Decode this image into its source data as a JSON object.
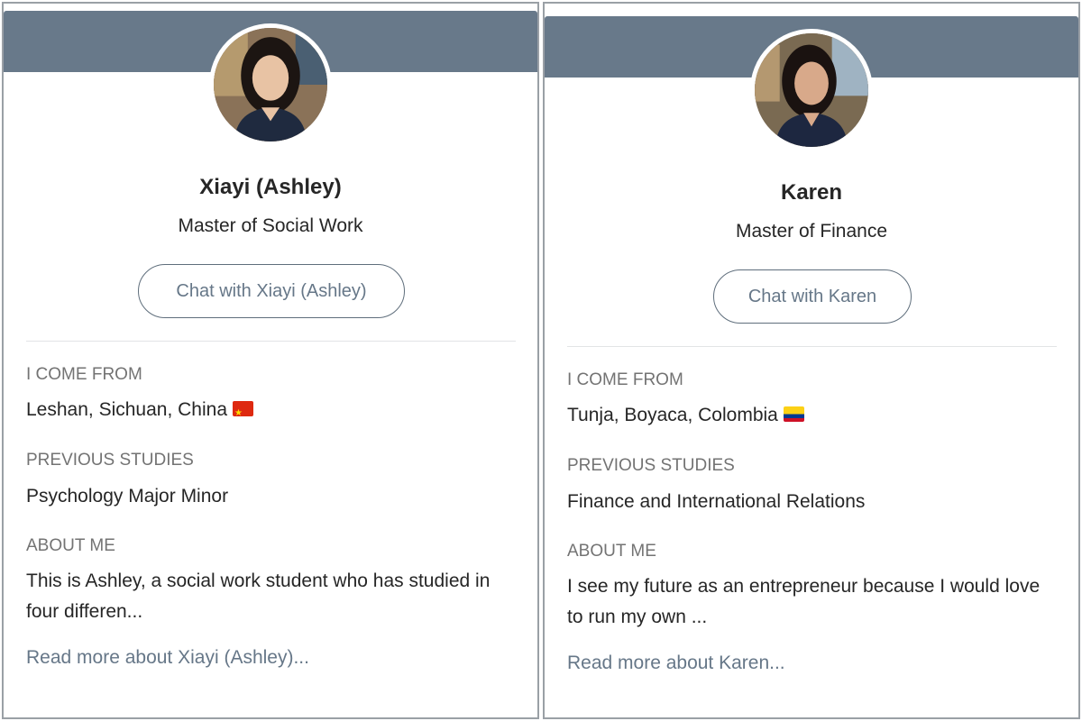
{
  "profiles": [
    {
      "name": "Xiayi (Ashley)",
      "program": "Master of Social Work",
      "chat_label": "Chat with Xiayi (Ashley)",
      "from_label": "I COME FROM",
      "from_value": "Leshan, Sichuan, China",
      "flag_icon": "china-flag-icon",
      "studies_label": "PREVIOUS STUDIES",
      "studies_value": "Psychology Major Minor",
      "about_label": "ABOUT ME",
      "about_value": "This is Ashley, a social work student who has studied in four differen...",
      "read_more": "Read more about Xiayi (Ashley)..."
    },
    {
      "name": "Karen",
      "program": "Master of Finance",
      "chat_label": "Chat with Karen",
      "from_label": "I COME FROM",
      "from_value": "Tunja, Boyaca, Colombia",
      "flag_icon": "colombia-flag-icon",
      "studies_label": "PREVIOUS STUDIES",
      "studies_value": "Finance and International Relations",
      "about_label": "ABOUT ME",
      "about_value": "I see my future as an entrepreneur because I would love to run my own ...",
      "read_more": "Read more about Karen..."
    }
  ],
  "colors": {
    "banner": "#68798a",
    "button_border": "#5f6e7c",
    "button_text": "#667788",
    "label": "#737373",
    "text": "#262626"
  }
}
